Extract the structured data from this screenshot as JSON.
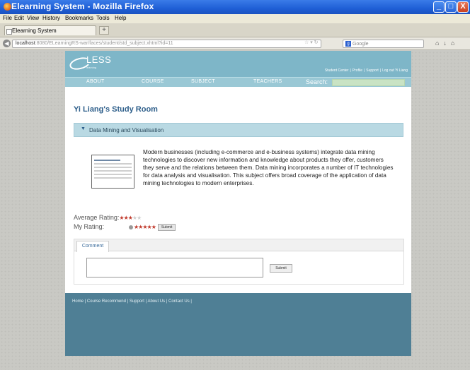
{
  "window": {
    "title": "Elearning System - Mozilla Firefox",
    "min_label": "_",
    "max_label": "□",
    "close_label": "X"
  },
  "menu": [
    "File",
    "Edit",
    "View",
    "History",
    "Bookmarks",
    "Tools",
    "Help"
  ],
  "tab": {
    "label": "Elearning System",
    "new_tab_label": "+"
  },
  "address": {
    "url_host": "localhost",
    "url_rest": ":8080/ELearningRS-war/faces/student/std_subject.xhtml?id=11",
    "search_placeholder": "Google",
    "search_engine_letter": "g"
  },
  "site": {
    "logo": "LESS",
    "logo_sub": "learning",
    "top_links": [
      "Student Center",
      "Profile",
      "Support",
      "Log out Yi Liang"
    ],
    "top_links_separator": "|",
    "nav": [
      "ABOUT",
      "COURSE",
      "SUBJECT",
      "TEACHERS"
    ],
    "search_label": "Search:",
    "page_title": "Yi Liang's Study Room",
    "section_title": "Data Mining and Visualisation",
    "description": "Modern businesses (including e-commerce and e-business systems) integrate data mining technologies to discover new information and knowledge about products they offer, customers they serve and the relations between them. Data mining incorporates a number of IT technologies for data analysis and visualisation. This subject offers broad coverage of the application of data mining technologies to modern enterprises.",
    "average_rating_label": "Average Rating:",
    "average_rating": 3,
    "my_rating_label": "My Rating:",
    "my_rating": 5,
    "rating_max": 5,
    "rating_submit": "Submit",
    "comment_tab": "Comment",
    "comment_value": "",
    "comment_submit": "Submit",
    "footer_links": [
      "Home",
      "Course Recommend",
      "Support",
      "About Us",
      "Contact Us"
    ],
    "footer_separator": "|"
  },
  "colors": {
    "header": "#7eb6c8",
    "footer": "#4f7f95",
    "title": "#2d5e8a",
    "star_on": "#c0392b"
  }
}
